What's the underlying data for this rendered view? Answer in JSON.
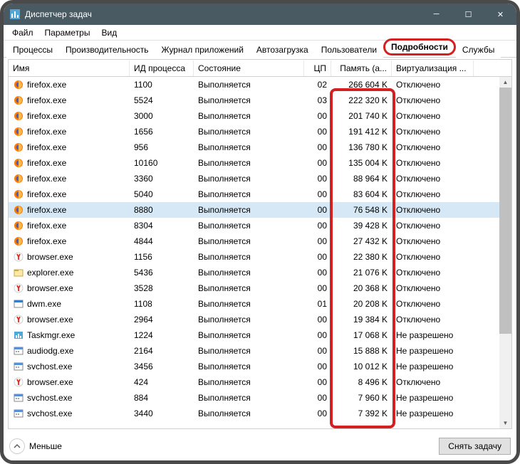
{
  "window": {
    "title": "Диспетчер задач"
  },
  "menu": [
    "Файл",
    "Параметры",
    "Вид"
  ],
  "tabs": [
    "Процессы",
    "Производительность",
    "Журнал приложений",
    "Автозагрузка",
    "Пользователи",
    "Подробности",
    "Службы"
  ],
  "highlighted_tab_index": 5,
  "columns": {
    "name": "Имя",
    "pid": "ИД процесса",
    "state": "Состояние",
    "cpu": "ЦП",
    "mem": "Память (а...",
    "virt": "Виртуализация ..."
  },
  "rows": [
    {
      "icon": "firefox",
      "name": "firefox.exe",
      "pid": "1100",
      "state": "Выполняется",
      "cpu": "02",
      "mem": "266 604 K",
      "virt": "Отключено",
      "sel": false
    },
    {
      "icon": "firefox",
      "name": "firefox.exe",
      "pid": "5524",
      "state": "Выполняется",
      "cpu": "03",
      "mem": "222 320 K",
      "virt": "Отключено",
      "sel": false
    },
    {
      "icon": "firefox",
      "name": "firefox.exe",
      "pid": "3000",
      "state": "Выполняется",
      "cpu": "00",
      "mem": "201 740 K",
      "virt": "Отключено",
      "sel": false
    },
    {
      "icon": "firefox",
      "name": "firefox.exe",
      "pid": "1656",
      "state": "Выполняется",
      "cpu": "00",
      "mem": "191 412 K",
      "virt": "Отключено",
      "sel": false
    },
    {
      "icon": "firefox",
      "name": "firefox.exe",
      "pid": "956",
      "state": "Выполняется",
      "cpu": "00",
      "mem": "136 780 K",
      "virt": "Отключено",
      "sel": false
    },
    {
      "icon": "firefox",
      "name": "firefox.exe",
      "pid": "10160",
      "state": "Выполняется",
      "cpu": "00",
      "mem": "135 004 K",
      "virt": "Отключено",
      "sel": false
    },
    {
      "icon": "firefox",
      "name": "firefox.exe",
      "pid": "3360",
      "state": "Выполняется",
      "cpu": "00",
      "mem": "88 964 K",
      "virt": "Отключено",
      "sel": false
    },
    {
      "icon": "firefox",
      "name": "firefox.exe",
      "pid": "5040",
      "state": "Выполняется",
      "cpu": "00",
      "mem": "83 604 K",
      "virt": "Отключено",
      "sel": false
    },
    {
      "icon": "firefox",
      "name": "firefox.exe",
      "pid": "8880",
      "state": "Выполняется",
      "cpu": "00",
      "mem": "76 548 K",
      "virt": "Отключено",
      "sel": true
    },
    {
      "icon": "firefox",
      "name": "firefox.exe",
      "pid": "8304",
      "state": "Выполняется",
      "cpu": "00",
      "mem": "39 428 K",
      "virt": "Отключено",
      "sel": false
    },
    {
      "icon": "firefox",
      "name": "firefox.exe",
      "pid": "4844",
      "state": "Выполняется",
      "cpu": "00",
      "mem": "27 432 K",
      "virt": "Отключено",
      "sel": false
    },
    {
      "icon": "yandex",
      "name": "browser.exe",
      "pid": "1156",
      "state": "Выполняется",
      "cpu": "00",
      "mem": "22 380 K",
      "virt": "Отключено",
      "sel": false
    },
    {
      "icon": "explorer",
      "name": "explorer.exe",
      "pid": "5436",
      "state": "Выполняется",
      "cpu": "00",
      "mem": "21 076 K",
      "virt": "Отключено",
      "sel": false
    },
    {
      "icon": "yandex",
      "name": "browser.exe",
      "pid": "3528",
      "state": "Выполняется",
      "cpu": "00",
      "mem": "20 368 K",
      "virt": "Отключено",
      "sel": false
    },
    {
      "icon": "dwm",
      "name": "dwm.exe",
      "pid": "1108",
      "state": "Выполняется",
      "cpu": "01",
      "mem": "20 208 K",
      "virt": "Отключено",
      "sel": false
    },
    {
      "icon": "yandex",
      "name": "browser.exe",
      "pid": "2964",
      "state": "Выполняется",
      "cpu": "00",
      "mem": "19 384 K",
      "virt": "Отключено",
      "sel": false
    },
    {
      "icon": "taskmgr",
      "name": "Taskmgr.exe",
      "pid": "1224",
      "state": "Выполняется",
      "cpu": "00",
      "mem": "17 068 K",
      "virt": "Не разрешено",
      "sel": false
    },
    {
      "icon": "svc",
      "name": "audiodg.exe",
      "pid": "2164",
      "state": "Выполняется",
      "cpu": "00",
      "mem": "15 888 K",
      "virt": "Не разрешено",
      "sel": false
    },
    {
      "icon": "svc",
      "name": "svchost.exe",
      "pid": "3456",
      "state": "Выполняется",
      "cpu": "00",
      "mem": "10 012 K",
      "virt": "Не разрешено",
      "sel": false
    },
    {
      "icon": "yandex",
      "name": "browser.exe",
      "pid": "424",
      "state": "Выполняется",
      "cpu": "00",
      "mem": "8 496 K",
      "virt": "Отключено",
      "sel": false
    },
    {
      "icon": "svc",
      "name": "svchost.exe",
      "pid": "884",
      "state": "Выполняется",
      "cpu": "00",
      "mem": "7 960 K",
      "virt": "Не разрешено",
      "sel": false
    },
    {
      "icon": "svc",
      "name": "svchost.exe",
      "pid": "3440",
      "state": "Выполняется",
      "cpu": "00",
      "mem": "7 392 K",
      "virt": "Не разрешено",
      "sel": false
    }
  ],
  "footer": {
    "less": "Меньше",
    "end_task": "Снять задачу"
  }
}
